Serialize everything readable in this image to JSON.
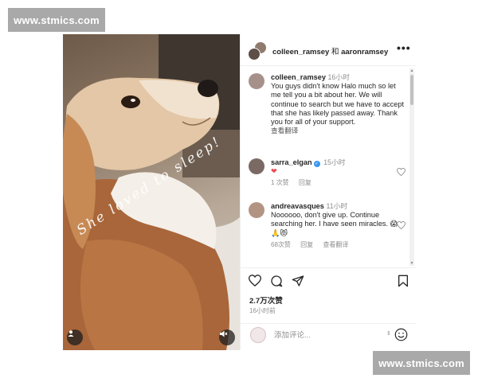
{
  "watermark": {
    "top_text": "www.stmics.com",
    "bottom_text": "www.stmics.com"
  },
  "photo": {
    "caption": "She loved to sleep!"
  },
  "header": {
    "user1": "colleen_ramsey",
    "joiner": "和",
    "user2": "aaronramsey",
    "more_label": "•••"
  },
  "comments": [
    {
      "username": "colleen_ramsey",
      "verified": false,
      "time": "16小时",
      "text": "You guys didn't know Halo much so let me tell you a bit about her. We will continue to search but we have to accept that she has likely passed away. Thank you for all of your support.",
      "translate": "查看翻译"
    },
    {
      "username": "sarra_elgan",
      "verified": true,
      "time": "15小时",
      "text": "❤",
      "likes": "1 次赞",
      "reply": "回复"
    },
    {
      "username": "andreavasques",
      "verified": false,
      "time": "11小时",
      "text": "Noooooo, don't give up. Continue searching her. I have seen miracles. 😱🙏😻",
      "likes": "68次赞",
      "reply": "回复",
      "translate": "查看翻译"
    }
  ],
  "likes_count": "2.7万次赞",
  "post_time": "16小时前",
  "comment_box": {
    "placeholder": "添加评论...",
    "value": ""
  },
  "colors": {
    "verified": "#3897f0",
    "heart": "#ed4956",
    "muted_text": "#8e8e8e"
  },
  "icons": [
    "user-tag-icon",
    "mute-icon",
    "more-icon",
    "heart-icon",
    "comment-icon",
    "share-icon",
    "bookmark-icon",
    "emoji-icon"
  ]
}
